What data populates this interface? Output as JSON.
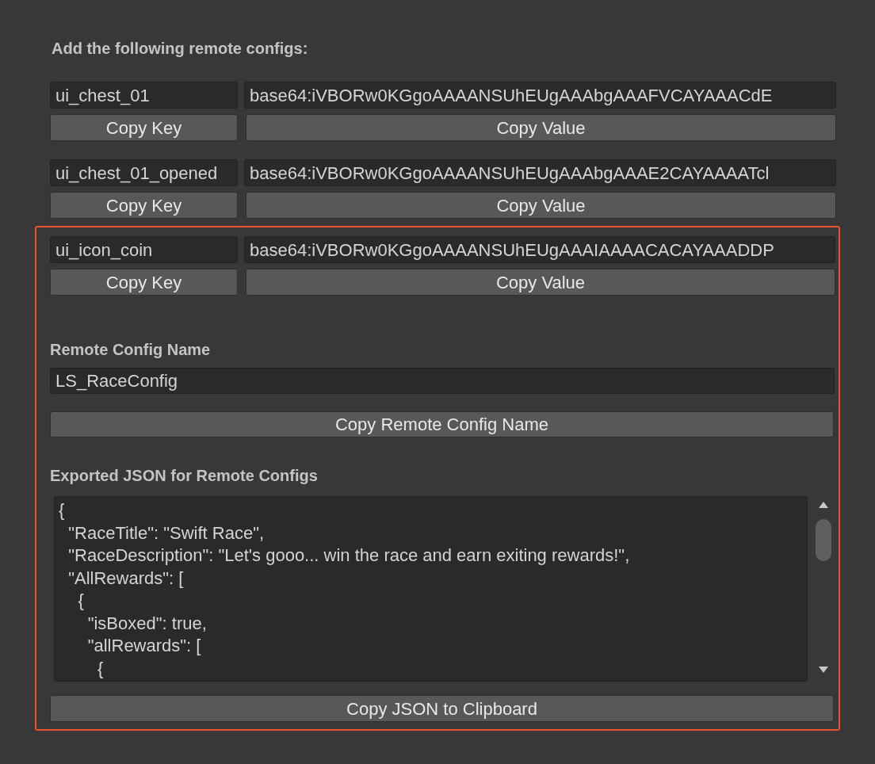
{
  "heading": "Add the following remote configs:",
  "entries": [
    {
      "key": "ui_chest_01",
      "value": "base64:iVBORw0KGgoAAAANSUhEUgAAAbgAAAFVCAYAAACdE",
      "key_button": "Copy Key",
      "value_button": "Copy Value"
    },
    {
      "key": "ui_chest_01_opened",
      "value": "base64:iVBORw0KGgoAAAANSUhEUgAAAbgAAAE2CAYAAAATcl",
      "key_button": "Copy Key",
      "value_button": "Copy Value"
    }
  ],
  "highlight_box": {
    "entries": [
      {
        "key": "ui_icon_coin",
        "value": "base64:iVBORw0KGgoAAAANSUhEUgAAAIAAAACACAYAAADDP",
        "key_button": "Copy Key",
        "value_button": "Copy Value"
      }
    ],
    "config_name": {
      "label": "Remote Config Name",
      "value": "LS_RaceConfig",
      "button": "Copy Remote Config Name"
    },
    "exported_json": {
      "label": "Exported JSON for Remote Configs",
      "text": "{\n  \"RaceTitle\": \"Swift Race\",\n  \"RaceDescription\": \"Let's gooo... win the race and earn exiting rewards!\",\n  \"AllRewards\": [\n    {\n      \"isBoxed\": true,\n      \"allRewards\": [\n        {",
      "button": "Copy JSON to Clipboard"
    }
  }
}
